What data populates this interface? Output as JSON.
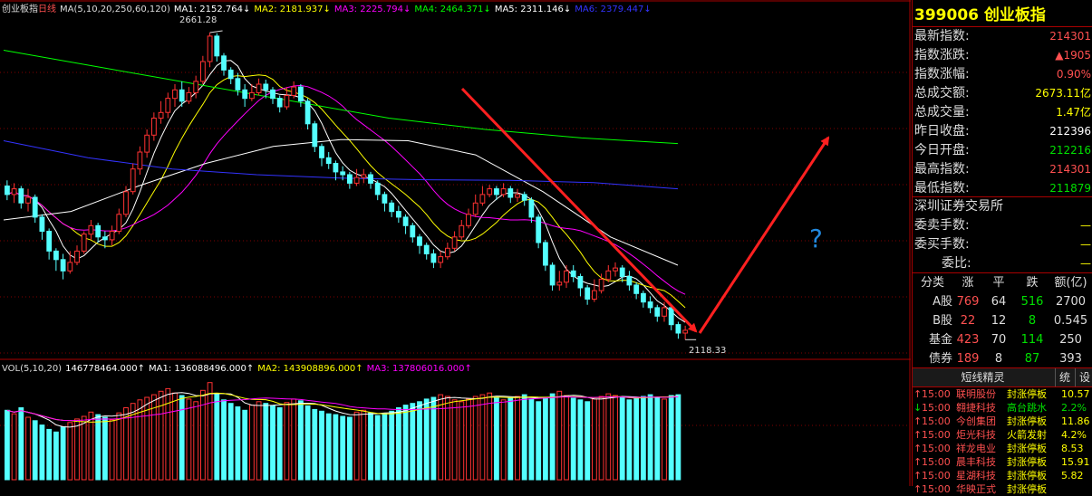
{
  "chart_header": {
    "name": "创业板指",
    "period": "日线",
    "ma_spec": "MA(5,10,20,250,60,120)",
    "ma": [
      {
        "label": "MA1:",
        "value": "2152.764↓",
        "color": "#ffffff"
      },
      {
        "label": "MA2:",
        "value": "2181.937↓",
        "color": "#ffff00"
      },
      {
        "label": "MA3:",
        "value": "2225.794↓",
        "color": "#ff00ff"
      },
      {
        "label": "MA4:",
        "value": "2464.371↓",
        "color": "#00ff00"
      },
      {
        "label": "MA5:",
        "value": "2311.146↓",
        "color": "#ffffff"
      },
      {
        "label": "MA6:",
        "value": "2379.447↓",
        "color": "#3333ff"
      }
    ]
  },
  "vol_header": {
    "spec": "VOL(5,10,20)",
    "vol": "146778464.000↑",
    "ma": [
      {
        "label": "MA1:",
        "value": "136088496.000↑",
        "color": "#ffffff"
      },
      {
        "label": "MA2:",
        "value": "143908896.000↑",
        "color": "#ffff00"
      },
      {
        "label": "MA3:",
        "value": "137806016.000↑",
        "color": "#ff00ff"
      }
    ]
  },
  "annotations": {
    "high_label": "2661.28",
    "low_label": "2118.33",
    "question": "?"
  },
  "colors": {
    "up": "#ff3232",
    "down": "#54ffff",
    "arrow": "#ff2020",
    "grid": "#800000"
  },
  "chart_data": [
    {
      "type": "candlestick",
      "title": "",
      "high": 2661.28,
      "low": 2118.33,
      "ylim": [
        2090,
        2690
      ],
      "candles": [
        [
          2390,
          2375,
          2400,
          2365
        ],
        [
          2375,
          2385,
          2395,
          2360
        ],
        [
          2385,
          2360,
          2390,
          2350
        ],
        [
          2360,
          2370,
          2385,
          2345
        ],
        [
          2370,
          2335,
          2375,
          2325
        ],
        [
          2335,
          2310,
          2340,
          2295
        ],
        [
          2310,
          2275,
          2315,
          2260
        ],
        [
          2275,
          2260,
          2280,
          2240
        ],
        [
          2260,
          2240,
          2270,
          2225
        ],
        [
          2240,
          2255,
          2275,
          2235
        ],
        [
          2255,
          2275,
          2285,
          2250
        ],
        [
          2275,
          2305,
          2310,
          2270
        ],
        [
          2305,
          2320,
          2330,
          2295
        ],
        [
          2320,
          2300,
          2325,
          2290
        ],
        [
          2300,
          2295,
          2310,
          2280
        ],
        [
          2295,
          2310,
          2320,
          2285
        ],
        [
          2310,
          2340,
          2350,
          2305
        ],
        [
          2340,
          2380,
          2390,
          2335
        ],
        [
          2380,
          2420,
          2430,
          2375
        ],
        [
          2420,
          2450,
          2460,
          2410
        ],
        [
          2450,
          2480,
          2490,
          2440
        ],
        [
          2480,
          2510,
          2520,
          2470
        ],
        [
          2510,
          2520,
          2540,
          2500
        ],
        [
          2520,
          2545,
          2555,
          2510
        ],
        [
          2545,
          2560,
          2570,
          2530
        ],
        [
          2560,
          2540,
          2575,
          2530
        ],
        [
          2540,
          2555,
          2565,
          2535
        ],
        [
          2555,
          2575,
          2585,
          2545
        ],
        [
          2575,
          2610,
          2620,
          2570
        ],
        [
          2610,
          2655,
          2661,
          2600
        ],
        [
          2655,
          2620,
          2660,
          2610
        ],
        [
          2620,
          2595,
          2625,
          2585
        ],
        [
          2595,
          2580,
          2600,
          2570
        ],
        [
          2580,
          2560,
          2590,
          2550
        ],
        [
          2560,
          2545,
          2570,
          2530
        ],
        [
          2545,
          2555,
          2570,
          2540
        ],
        [
          2555,
          2570,
          2580,
          2550
        ],
        [
          2570,
          2560,
          2578,
          2545
        ],
        [
          2560,
          2545,
          2565,
          2535
        ],
        [
          2545,
          2530,
          2550,
          2520
        ],
        [
          2530,
          2550,
          2565,
          2525
        ],
        [
          2550,
          2565,
          2575,
          2545
        ],
        [
          2565,
          2540,
          2570,
          2530
        ],
        [
          2540,
          2500,
          2545,
          2490
        ],
        [
          2500,
          2460,
          2505,
          2450
        ],
        [
          2460,
          2440,
          2465,
          2425
        ],
        [
          2440,
          2430,
          2450,
          2420
        ],
        [
          2430,
          2415,
          2435,
          2400
        ],
        [
          2415,
          2410,
          2425,
          2400
        ],
        [
          2410,
          2395,
          2415,
          2385
        ],
        [
          2395,
          2405,
          2420,
          2390
        ],
        [
          2405,
          2410,
          2420,
          2395
        ],
        [
          2410,
          2395,
          2415,
          2385
        ],
        [
          2395,
          2375,
          2400,
          2365
        ],
        [
          2375,
          2360,
          2380,
          2345
        ],
        [
          2360,
          2345,
          2365,
          2335
        ],
        [
          2345,
          2335,
          2355,
          2325
        ],
        [
          2335,
          2320,
          2340,
          2305
        ],
        [
          2320,
          2300,
          2325,
          2290
        ],
        [
          2300,
          2285,
          2305,
          2270
        ],
        [
          2285,
          2270,
          2290,
          2260
        ],
        [
          2270,
          2255,
          2278,
          2245
        ],
        [
          2255,
          2265,
          2275,
          2245
        ],
        [
          2265,
          2280,
          2290,
          2260
        ],
        [
          2280,
          2300,
          2310,
          2275
        ],
        [
          2300,
          2320,
          2330,
          2295
        ],
        [
          2320,
          2340,
          2350,
          2315
        ],
        [
          2340,
          2360,
          2375,
          2335
        ],
        [
          2360,
          2375,
          2390,
          2355
        ],
        [
          2375,
          2385,
          2392,
          2370
        ],
        [
          2385,
          2375,
          2390,
          2365
        ],
        [
          2375,
          2385,
          2395,
          2370
        ],
        [
          2385,
          2370,
          2390,
          2360
        ],
        [
          2370,
          2375,
          2385,
          2362
        ],
        [
          2375,
          2365,
          2380,
          2355
        ],
        [
          2365,
          2335,
          2370,
          2325
        ],
        [
          2335,
          2290,
          2340,
          2280
        ],
        [
          2290,
          2250,
          2295,
          2240
        ],
        [
          2250,
          2215,
          2255,
          2205
        ],
        [
          2215,
          2220,
          2240,
          2205
        ],
        [
          2220,
          2240,
          2250,
          2210
        ],
        [
          2240,
          2230,
          2250,
          2220
        ],
        [
          2230,
          2210,
          2235,
          2195
        ],
        [
          2210,
          2190,
          2215,
          2180
        ],
        [
          2190,
          2205,
          2225,
          2185
        ],
        [
          2205,
          2225,
          2235,
          2200
        ],
        [
          2225,
          2240,
          2250,
          2220
        ],
        [
          2240,
          2245,
          2255,
          2230
        ],
        [
          2245,
          2230,
          2250,
          2220
        ],
        [
          2230,
          2215,
          2240,
          2205
        ],
        [
          2215,
          2200,
          2220,
          2190
        ],
        [
          2200,
          2185,
          2205,
          2175
        ],
        [
          2185,
          2175,
          2195,
          2165
        ],
        [
          2175,
          2160,
          2180,
          2150
        ],
        [
          2160,
          2175,
          2185,
          2150
        ],
        [
          2175,
          2145,
          2180,
          2135
        ],
        [
          2145,
          2130,
          2150,
          2120
        ],
        [
          2130,
          2135,
          2143,
          2118.33
        ]
      ],
      "ma_lines": [
        {
          "name": "MA1",
          "color": "#ffffff"
        },
        {
          "name": "MA2",
          "color": "#ffff00"
        },
        {
          "name": "MA3",
          "color": "#ff00ff"
        },
        {
          "name": "MA4",
          "color": "#00ff00",
          "values": [
            2630,
            2600,
            2570,
            2540,
            2510,
            2490,
            2475,
            2465
          ]
        },
        {
          "name": "MA5",
          "color": "#ffffff",
          "values": [
            2330,
            2345,
            2390,
            2430,
            2460,
            2472,
            2470,
            2445,
            2380,
            2300,
            2250
          ]
        },
        {
          "name": "MA6",
          "color": "#3333ff",
          "values": [
            2470,
            2440,
            2420,
            2410,
            2404,
            2401,
            2400,
            2396,
            2385
          ]
        }
      ]
    },
    {
      "type": "bar",
      "title": "",
      "volumes": [
        80,
        76,
        83,
        72,
        68,
        63,
        58,
        55,
        61,
        66,
        70,
        73,
        78,
        75,
        72,
        69,
        77,
        83,
        88,
        92,
        95,
        98,
        102,
        105,
        100,
        97,
        93,
        90,
        103,
        112,
        99,
        92,
        88,
        84,
        80,
        86,
        90,
        88,
        85,
        83,
        89,
        93,
        91,
        85,
        81,
        79,
        76,
        75,
        73,
        72,
        78,
        80,
        77,
        74,
        76,
        79,
        83,
        86,
        88,
        90,
        93,
        95,
        98,
        96,
        92,
        90,
        93,
        96,
        98,
        100,
        95,
        92,
        94,
        96,
        98,
        93,
        90,
        95,
        99,
        102,
        97,
        94,
        92,
        90,
        93,
        96,
        99,
        97,
        95,
        92,
        94,
        96,
        98,
        95,
        93,
        97,
        98
      ],
      "ylim": [
        0,
        120
      ]
    }
  ],
  "quote": {
    "code": "399006",
    "name": "创业板指",
    "rows": [
      {
        "label": "最新指数:",
        "value": "214301",
        "cls": "red"
      },
      {
        "label": "指数涨跌:",
        "value": "▲1905",
        "cls": "red"
      },
      {
        "label": "指数涨幅:",
        "value": "0.90%",
        "cls": "red"
      },
      {
        "label": "总成交额:",
        "value": "2673.11亿",
        "cls": "yel"
      },
      {
        "label": "总成交量:",
        "value": "1.47亿",
        "cls": "yel"
      },
      {
        "label": "昨日收盘:",
        "value": "212396",
        "cls": "wht"
      },
      {
        "label": "今日开盘:",
        "value": "212216",
        "cls": "grn"
      },
      {
        "label": "最高指数:",
        "value": "214301",
        "cls": "red"
      },
      {
        "label": "最低指数:",
        "value": "211879",
        "cls": "grn"
      }
    ],
    "exchange": "深圳证券交易所",
    "orders": [
      {
        "label": "委卖手数:",
        "value": "—"
      },
      {
        "label": "委买手数:",
        "value": "—"
      },
      {
        "label": "委比:",
        "value": "—"
      }
    ],
    "stats_header": [
      "分类",
      "涨",
      "平",
      "跌",
      "额(亿)"
    ],
    "stats": [
      {
        "cat": "A股",
        "up": "769",
        "flat": "64",
        "down": "516",
        "amt": "2700"
      },
      {
        "cat": "B股",
        "up": "22",
        "flat": "12",
        "down": "8",
        "amt": "0.545"
      },
      {
        "cat": "基金",
        "up": "423",
        "flat": "70",
        "down": "114",
        "amt": "250"
      },
      {
        "cat": "债券",
        "up": "189",
        "flat": "8",
        "down": "87",
        "amt": "393"
      }
    ],
    "tabs": [
      "短线精灵",
      "统",
      "设"
    ],
    "news": [
      {
        "arrow": "↑",
        "time": "15:00",
        "name": "联明股份",
        "event": "封涨停板",
        "val": "10.57",
        "up": true
      },
      {
        "arrow": "↓",
        "time": "15:00",
        "name": "翱捷科技",
        "event": "高台跳水",
        "val": "2.2%",
        "up": false
      },
      {
        "arrow": "↑",
        "time": "15:00",
        "name": "今创集团",
        "event": "封涨停板",
        "val": "11.86",
        "up": true
      },
      {
        "arrow": "↑",
        "time": "15:00",
        "name": "炬光科技",
        "event": "火箭发射",
        "val": "4.2%",
        "up": true
      },
      {
        "arrow": "↑",
        "time": "15:00",
        "name": "祥龙电业",
        "event": "封涨停板",
        "val": "8.53",
        "up": true
      },
      {
        "arrow": "↑",
        "time": "15:00",
        "name": "晨丰科技",
        "event": "封涨停板",
        "val": "15.91",
        "up": true
      },
      {
        "arrow": "↑",
        "time": "15:00",
        "name": "星湖科技",
        "event": "封涨停板",
        "val": "5.82",
        "up": true
      },
      {
        "arrow": "↑",
        "time": "15:00",
        "name": "华映正式",
        "event": "封涨停板",
        "val": "",
        "up": true
      }
    ]
  }
}
